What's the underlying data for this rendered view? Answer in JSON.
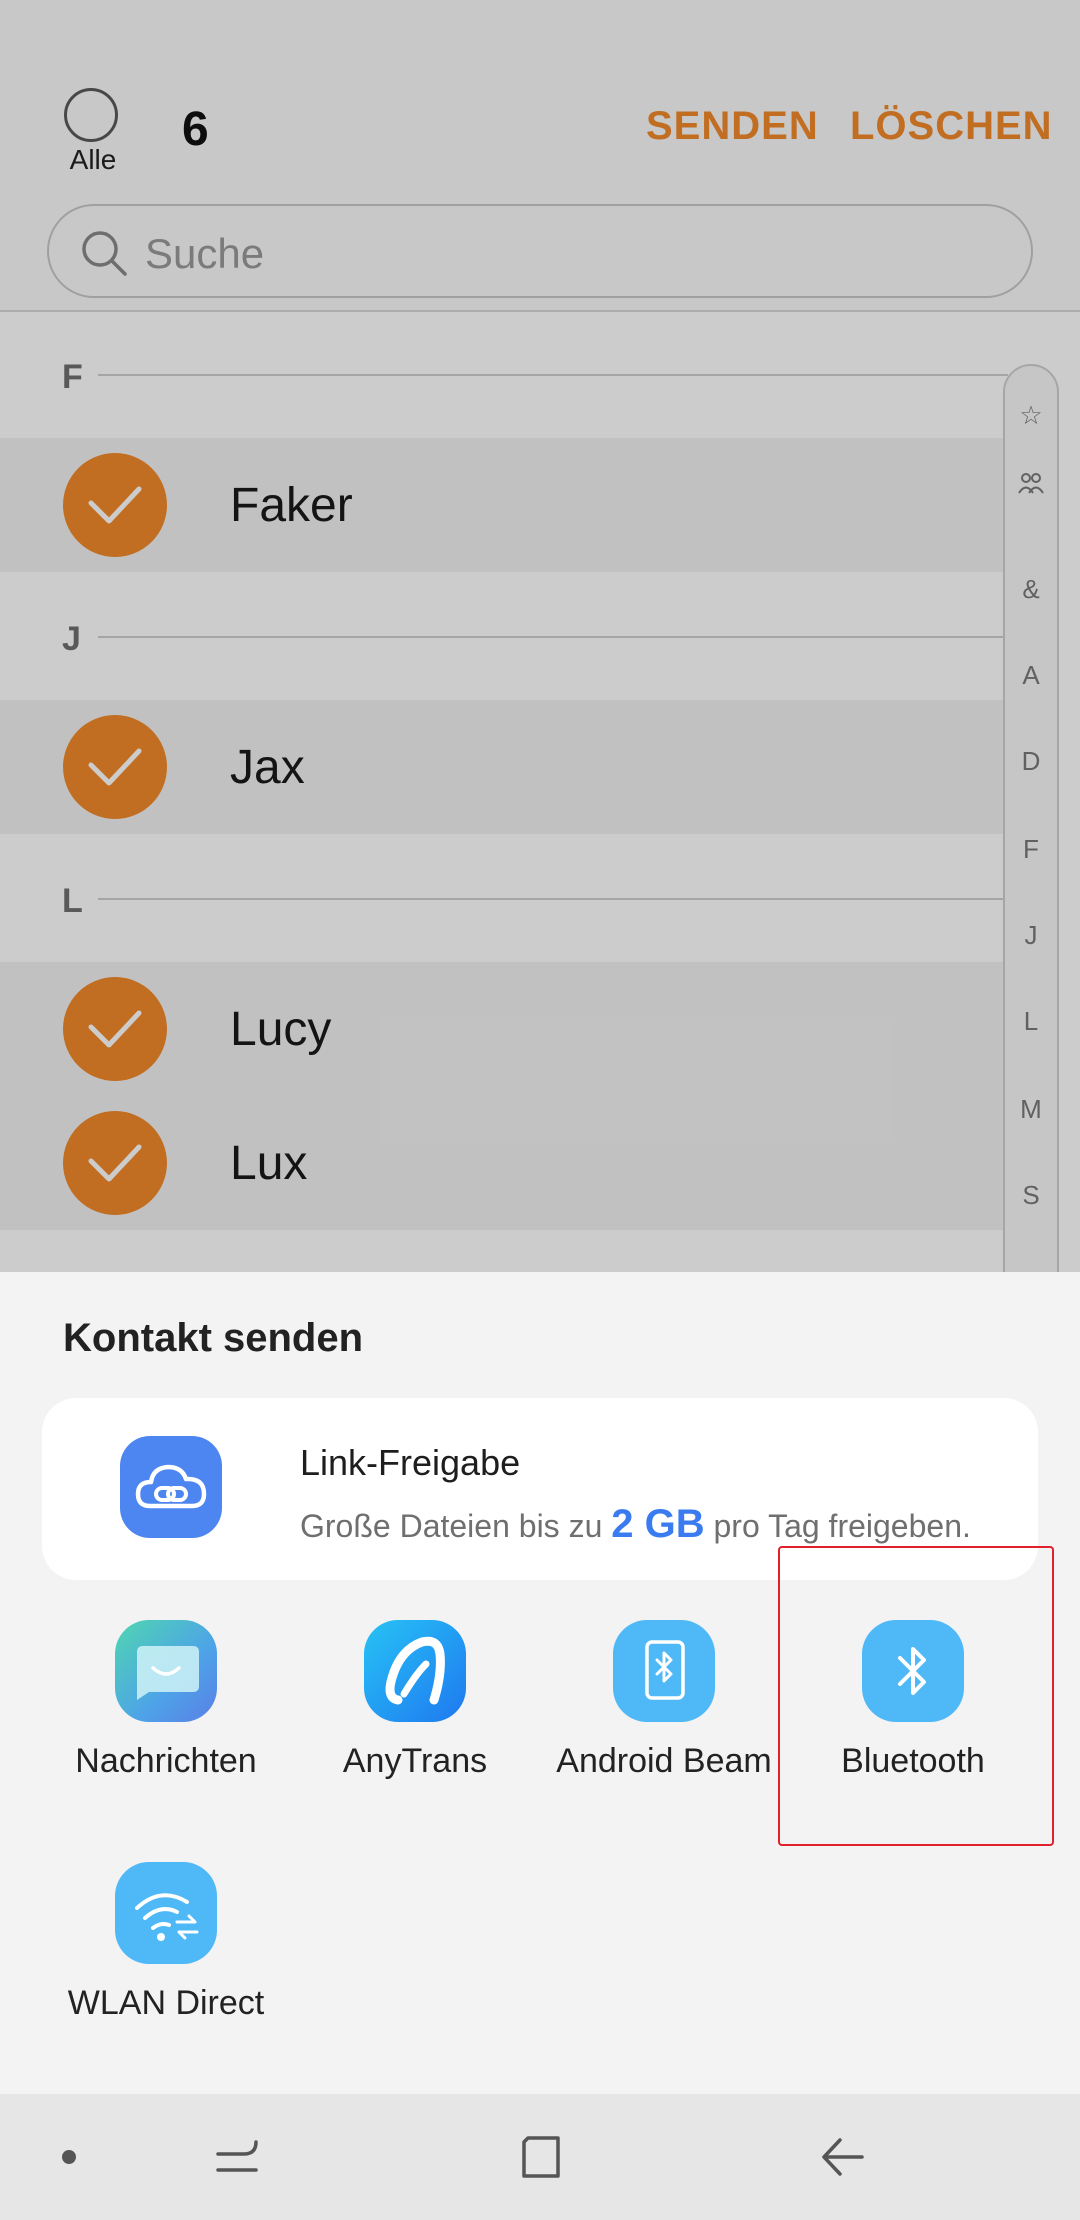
{
  "header": {
    "select_all_label": "Alle",
    "selected_count": "6",
    "send_label": "SENDEN",
    "delete_label": "LÖSCHEN",
    "search_placeholder": "Suche"
  },
  "sections": [
    {
      "letter": "F",
      "contacts": [
        "Faker"
      ]
    },
    {
      "letter": "J",
      "contacts": [
        "Jax"
      ]
    },
    {
      "letter": "L",
      "contacts": [
        "Lucy",
        "Lux"
      ]
    }
  ],
  "index_bar": [
    "☆",
    "group-icon",
    "&",
    "A",
    "D",
    "F",
    "J",
    "L",
    "M",
    "S"
  ],
  "share_sheet": {
    "title": "Kontakt senden",
    "link_share": {
      "title": "Link-Freigabe",
      "subtitle_before": "Große Dateien bis zu",
      "subtitle_highlight": "2 GB",
      "subtitle_after": "pro Tag freigeben."
    },
    "apps": [
      {
        "label": "Nachrichten",
        "icon": "messages-icon"
      },
      {
        "label": "AnyTrans",
        "icon": "anytrans-icon"
      },
      {
        "label": "Android Beam",
        "icon": "android-beam-icon"
      },
      {
        "label": "Bluetooth",
        "icon": "bluetooth-icon"
      },
      {
        "label": "WLAN Direct",
        "icon": "wifi-direct-icon"
      }
    ]
  },
  "colors": {
    "accent_orange": "#f28a2b",
    "link_blue": "#3a7cf0",
    "highlight_red": "#e0202a"
  }
}
